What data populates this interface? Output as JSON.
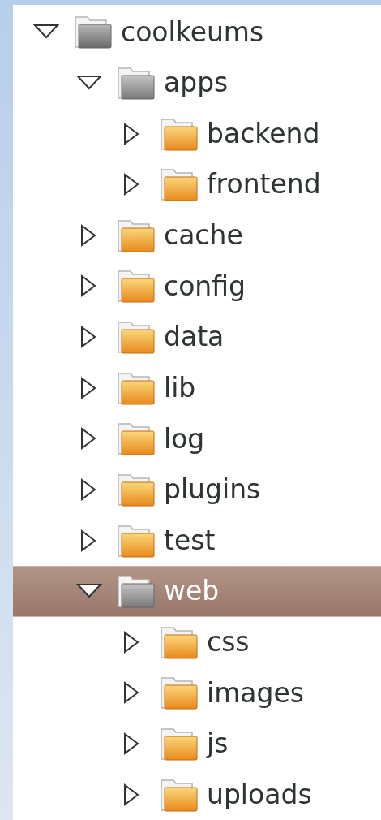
{
  "tree": [
    {
      "label": "coolkeums",
      "expanded": true,
      "selected": false,
      "children": [
        {
          "label": "apps",
          "expanded": true,
          "selected": false,
          "children": [
            {
              "label": "backend",
              "expanded": false,
              "selected": false
            },
            {
              "label": "frontend",
              "expanded": false,
              "selected": false
            }
          ]
        },
        {
          "label": "cache",
          "expanded": false,
          "selected": false
        },
        {
          "label": "config",
          "expanded": false,
          "selected": false
        },
        {
          "label": "data",
          "expanded": false,
          "selected": false
        },
        {
          "label": "lib",
          "expanded": false,
          "selected": false
        },
        {
          "label": "log",
          "expanded": false,
          "selected": false
        },
        {
          "label": "plugins",
          "expanded": false,
          "selected": false
        },
        {
          "label": "test",
          "expanded": false,
          "selected": false
        },
        {
          "label": "web",
          "expanded": true,
          "selected": true,
          "children": [
            {
              "label": "css",
              "expanded": false,
              "selected": false
            },
            {
              "label": "images",
              "expanded": false,
              "selected": false
            },
            {
              "label": "js",
              "expanded": false,
              "selected": false
            },
            {
              "label": "uploads",
              "expanded": false,
              "selected": false
            }
          ]
        }
      ]
    }
  ]
}
